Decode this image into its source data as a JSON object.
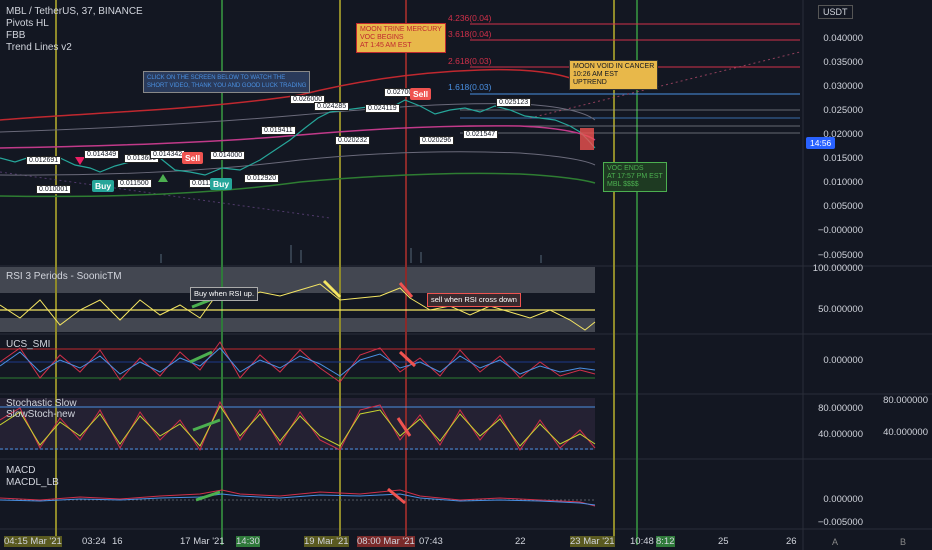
{
  "header": {
    "symbol_line": "MBL / TetherUS, 37, BINANCE",
    "indicators": [
      "Pivots HL",
      "FBB",
      "Trend Lines v2"
    ],
    "currency": "USDT"
  },
  "price_axis": {
    "ticks": [
      "0.040000",
      "0.035000",
      "0.030000",
      "0.025000",
      "0.020000",
      "0.015000",
      "0.010000",
      "0.005000",
      "−0.000000",
      "−0.005000"
    ],
    "current_badge": "14:56"
  },
  "panes": {
    "rsi": {
      "title": "RSI 3 Periods - SoonicTM",
      "ticks": [
        "100.000000",
        "50.000000"
      ]
    },
    "smi": {
      "title": "UCS_SMI",
      "ticks": [
        "0.000000"
      ]
    },
    "stoch": {
      "titles": [
        "Stochastic Slow",
        "SlowStoch-new"
      ],
      "ticks": [
        "80.000000",
        "40.000000"
      ],
      "ticks_right": [
        "80.000000",
        "40.000000"
      ]
    },
    "macd": {
      "titles": [
        "MACD",
        "MACDL_LB"
      ],
      "ticks": [
        "0.000000",
        "−0.005000"
      ]
    }
  },
  "time_axis": {
    "ticks": [
      "04:15 Mar '21",
      "03:24",
      "16",
      "17 Mar '21",
      "14:30",
      "19 Mar '21",
      "08:00 Mar '21",
      "07:43",
      "22",
      "23 Mar '21",
      "10:48",
      "8:12",
      "25",
      "26"
    ]
  },
  "annotations": {
    "moon_trine": "MOON TRINE MERCURY\nVOC BEGINS\nAT 1:45 AM EST",
    "moon_void": "MOON VOID IN CANCER\n10:26 AM EST\nUPTREND",
    "voc_ends": "VOC ENDS\nAT 17:57 PM EST\nMBL $$$$",
    "blue_note": "CLICK ON THE SCREEN BELOW TO WATCH THE\nSHORT VIDEO, THANK YOU AND GOOD LUCK TRADING",
    "rsi_buy": "Buy when RSI up.",
    "rsi_sell": "sell when RSI cross down"
  },
  "fib_levels": [
    "4.236(0.04)",
    "3.618(0.04)",
    "2.618(0.03)",
    "1.618(0.03)"
  ],
  "price_labels": [
    "0.012691",
    "0.014349",
    "0.013600",
    "0.014342",
    "0.014000",
    "0.010001",
    "0.011500",
    "0.011150",
    "0.012920",
    "0.019411",
    "0.026000",
    "0.024285",
    "0.024119",
    "0.027000",
    "0.025123",
    "0.020232",
    "0.020296",
    "0.021547"
  ],
  "signals": {
    "buy": "Buy",
    "sell": "Sell"
  },
  "footer_buttons": [
    "A",
    "B"
  ],
  "colors": {
    "background": "#131722",
    "price_line": "#4a90e2",
    "fib_red": "#d0304a",
    "rsi_line": "#f5e663",
    "band_green": "#2e7d32",
    "vline_yellow": "#8f8a2a",
    "vline_green": "#2f7a3a",
    "vline_red": "#8a2a2a"
  }
}
